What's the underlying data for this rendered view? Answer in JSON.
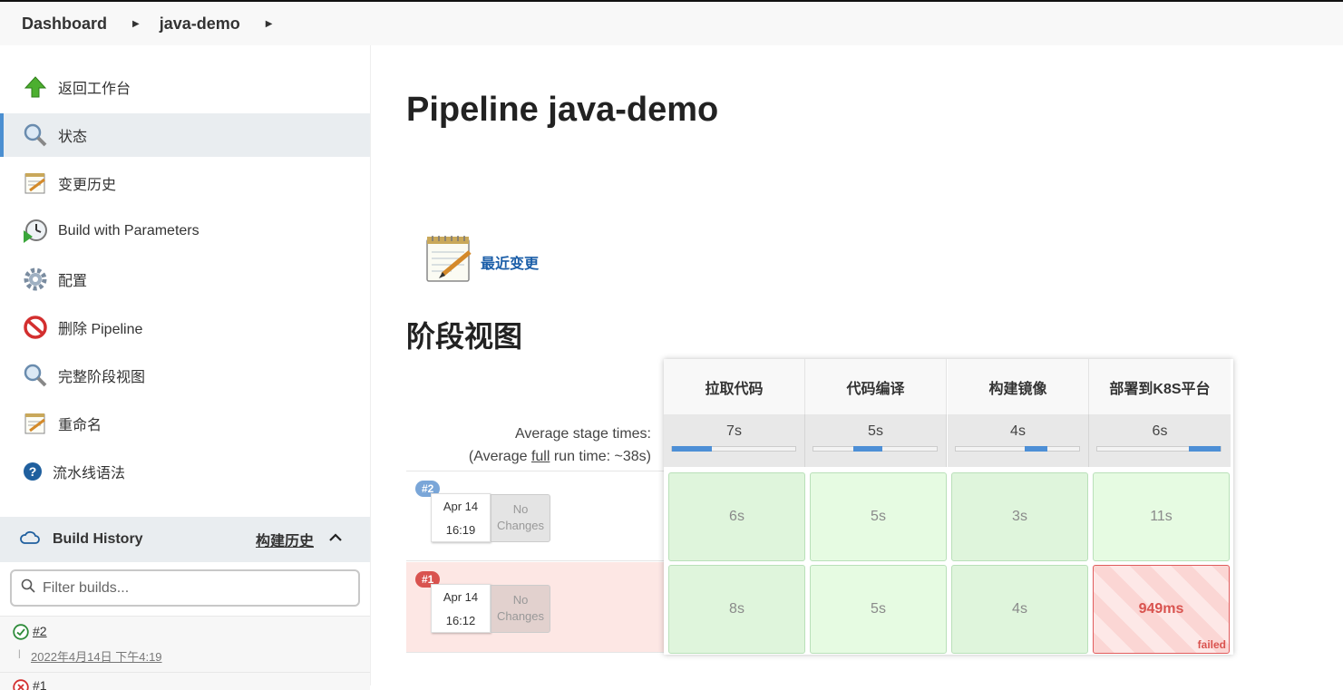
{
  "breadcrumb": {
    "items": [
      "Dashboard",
      "java-demo"
    ]
  },
  "sidebar": {
    "tasks": [
      {
        "label": "返回工作台",
        "icon": "up-arrow-icon"
      },
      {
        "label": "状态",
        "icon": "magnifier-icon"
      },
      {
        "label": "变更历史",
        "icon": "notepad-icon"
      },
      {
        "label": "Build with Parameters",
        "icon": "clock-play-icon"
      },
      {
        "label": "配置",
        "icon": "gear-icon"
      },
      {
        "label": "删除 Pipeline",
        "icon": "no-entry-icon"
      },
      {
        "label": "完整阶段视图",
        "icon": "magnifier-icon"
      },
      {
        "label": "重命名",
        "icon": "notepad-icon"
      },
      {
        "label": "流水线语法",
        "icon": "help-icon"
      }
    ],
    "build_history": {
      "title": "Build History",
      "link": "构建历史",
      "filter_placeholder": "Filter builds...",
      "builds": [
        {
          "number": "#2",
          "date": "2022年4月14日 下午4:19",
          "status": "success"
        },
        {
          "number": "#1",
          "date": "",
          "status": "failed"
        }
      ]
    }
  },
  "main": {
    "title": "Pipeline java-demo",
    "recent_changes": "最近变更",
    "stage_view_title": "阶段视图",
    "avg_label": "Average stage times:",
    "avg_full_prefix": "(Average ",
    "avg_full_word": "full",
    "avg_full_suffix": " run time: ~38s)",
    "stages": [
      {
        "name": "拉取代码",
        "avg": "7s",
        "bar_start": 0.0,
        "bar_end": 0.32
      },
      {
        "name": "代码编译",
        "avg": "5s",
        "bar_start": 0.32,
        "bar_end": 0.56
      },
      {
        "name": "构建镜像",
        "avg": "4s",
        "bar_start": 0.56,
        "bar_end": 0.74
      },
      {
        "name": "部署到K8S平台",
        "avg": "6s",
        "bar_start": 0.74,
        "bar_end": 1.0
      }
    ],
    "runs": [
      {
        "badge": "#2",
        "date": "Apr 14",
        "time": "16:19",
        "changes_line1": "No",
        "changes_line2": "Changes",
        "stage_times": [
          "6s",
          "5s",
          "3s",
          "11s"
        ],
        "status": "success"
      },
      {
        "badge": "#1",
        "date": "Apr 14",
        "time": "16:12",
        "changes_line1": "No",
        "changes_line2": "Changes",
        "stage_times": [
          "8s",
          "5s",
          "4s",
          "949ms"
        ],
        "status": "failed",
        "failed_label": "failed"
      }
    ]
  },
  "colors": {
    "accent": "#4b8fd1",
    "success": "#2e8b3a",
    "failure": "#d9534f",
    "link": "#1b5ea8"
  }
}
